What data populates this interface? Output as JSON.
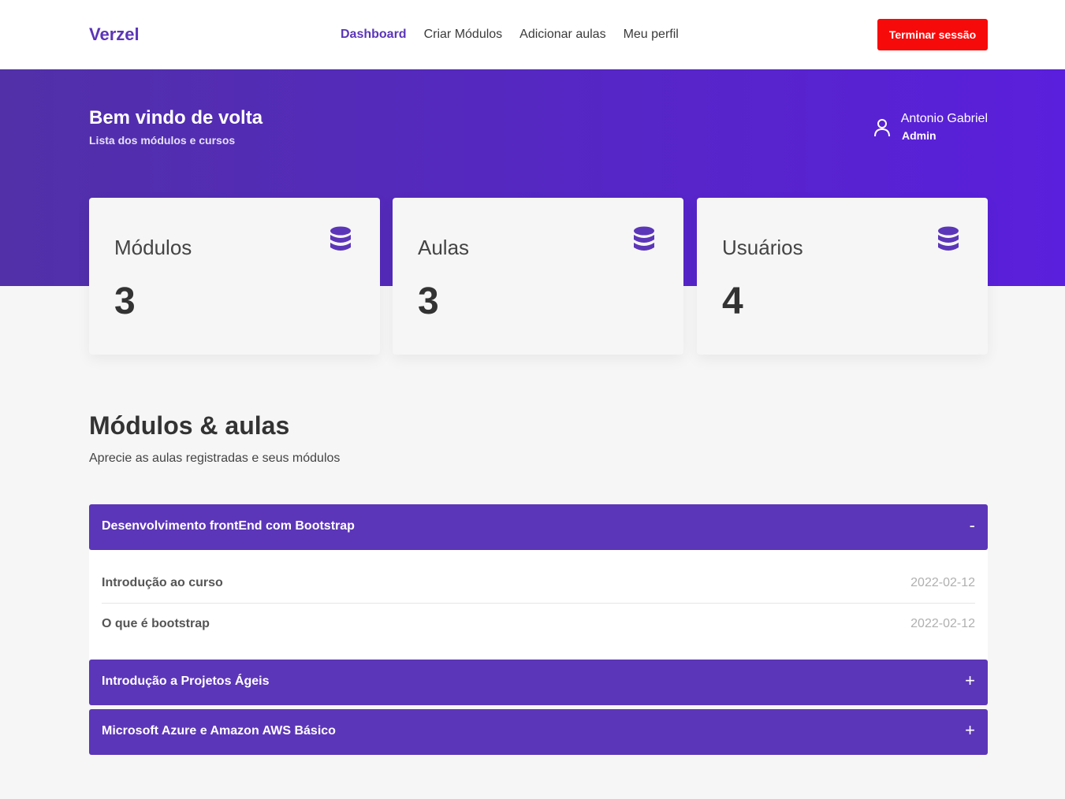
{
  "navbar": {
    "brand": "Verzel",
    "links": [
      {
        "label": "Dashboard",
        "active": true
      },
      {
        "label": "Criar Módulos",
        "active": false
      },
      {
        "label": "Adicionar aulas",
        "active": false
      },
      {
        "label": "Meu perfil",
        "active": false
      }
    ],
    "logout_label": "Terminar sessão"
  },
  "hero": {
    "title": "Bem vindo de volta",
    "subtitle": "Lista dos módulos e cursos",
    "user": {
      "name": "Antonio Gabriel",
      "role": "Admin",
      "icon": "user-icon"
    }
  },
  "stats": [
    {
      "label": "Módulos",
      "value": "3",
      "icon": "database-icon"
    },
    {
      "label": "Aulas",
      "value": "3",
      "icon": "database-icon"
    },
    {
      "label": "Usuários",
      "value": "4",
      "icon": "database-icon"
    }
  ],
  "section": {
    "title": "Módulos & aulas",
    "subtitle": "Aprecie as aulas registradas e seus módulos"
  },
  "modules": [
    {
      "title": "Desenvolvimento frontEnd com Bootstrap",
      "toggle": "-",
      "expanded": true,
      "lessons": [
        {
          "name": "Introdução ao curso",
          "date": "2022-02-12"
        },
        {
          "name": "O que é bootstrap",
          "date": "2022-02-12"
        }
      ]
    },
    {
      "title": "Introdução a Projetos Ágeis",
      "toggle": "+",
      "expanded": false
    },
    {
      "title": "Microsoft Azure e Amazon AWS Básico",
      "toggle": "+",
      "expanded": false
    }
  ],
  "colors": {
    "primary": "#5c36b8",
    "hero_start": "#5130a8",
    "hero_end": "#5a1fdc",
    "danger": "#f70a0a"
  }
}
